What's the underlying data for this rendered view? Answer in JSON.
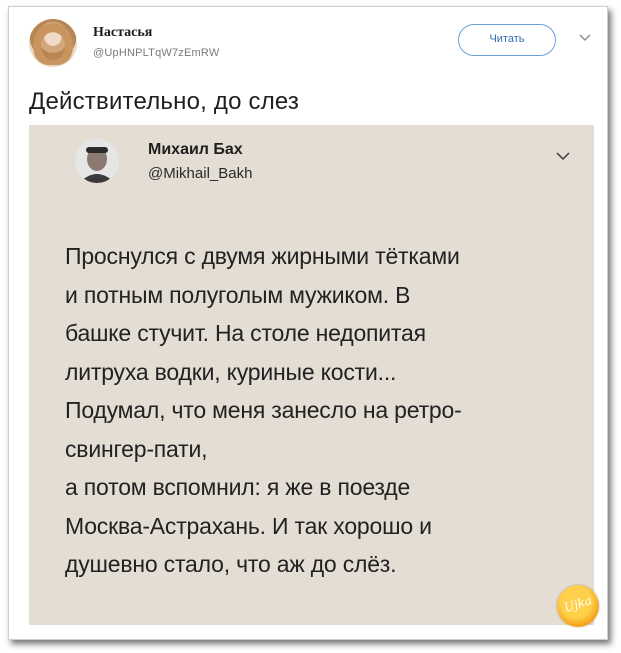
{
  "tweet": {
    "author_name": "Настасья",
    "author_handle": "@UpHNPLTqW7zEmRW",
    "follow_label": "Читать",
    "text": "Действительно, до слез"
  },
  "embedded_tweet": {
    "author_name": "Михаил Бах",
    "author_handle": "@Mikhail_Bakh",
    "lines": [
      "Проснулся с двумя жирными тётками",
      "и потным полуголым мужиком. В",
      "башке стучит. На столе недопитая",
      "литруха водки, куриные кости...",
      "Подумал, что меня занесло на ретро-",
      "свингер-пати,",
      "а потом вспомнил: я же в поезде",
      "Москва-Астрахань. И так хорошо и",
      "душевно стало, что аж до слёз."
    ]
  },
  "watermark": {
    "text": "Ujka"
  },
  "icons": {
    "menu": "chevron-down-icon",
    "inner_menu": "chevron-down-icon"
  },
  "colors": {
    "accent": "#2f6fb5",
    "card_bg": "#e3ddd3"
  }
}
